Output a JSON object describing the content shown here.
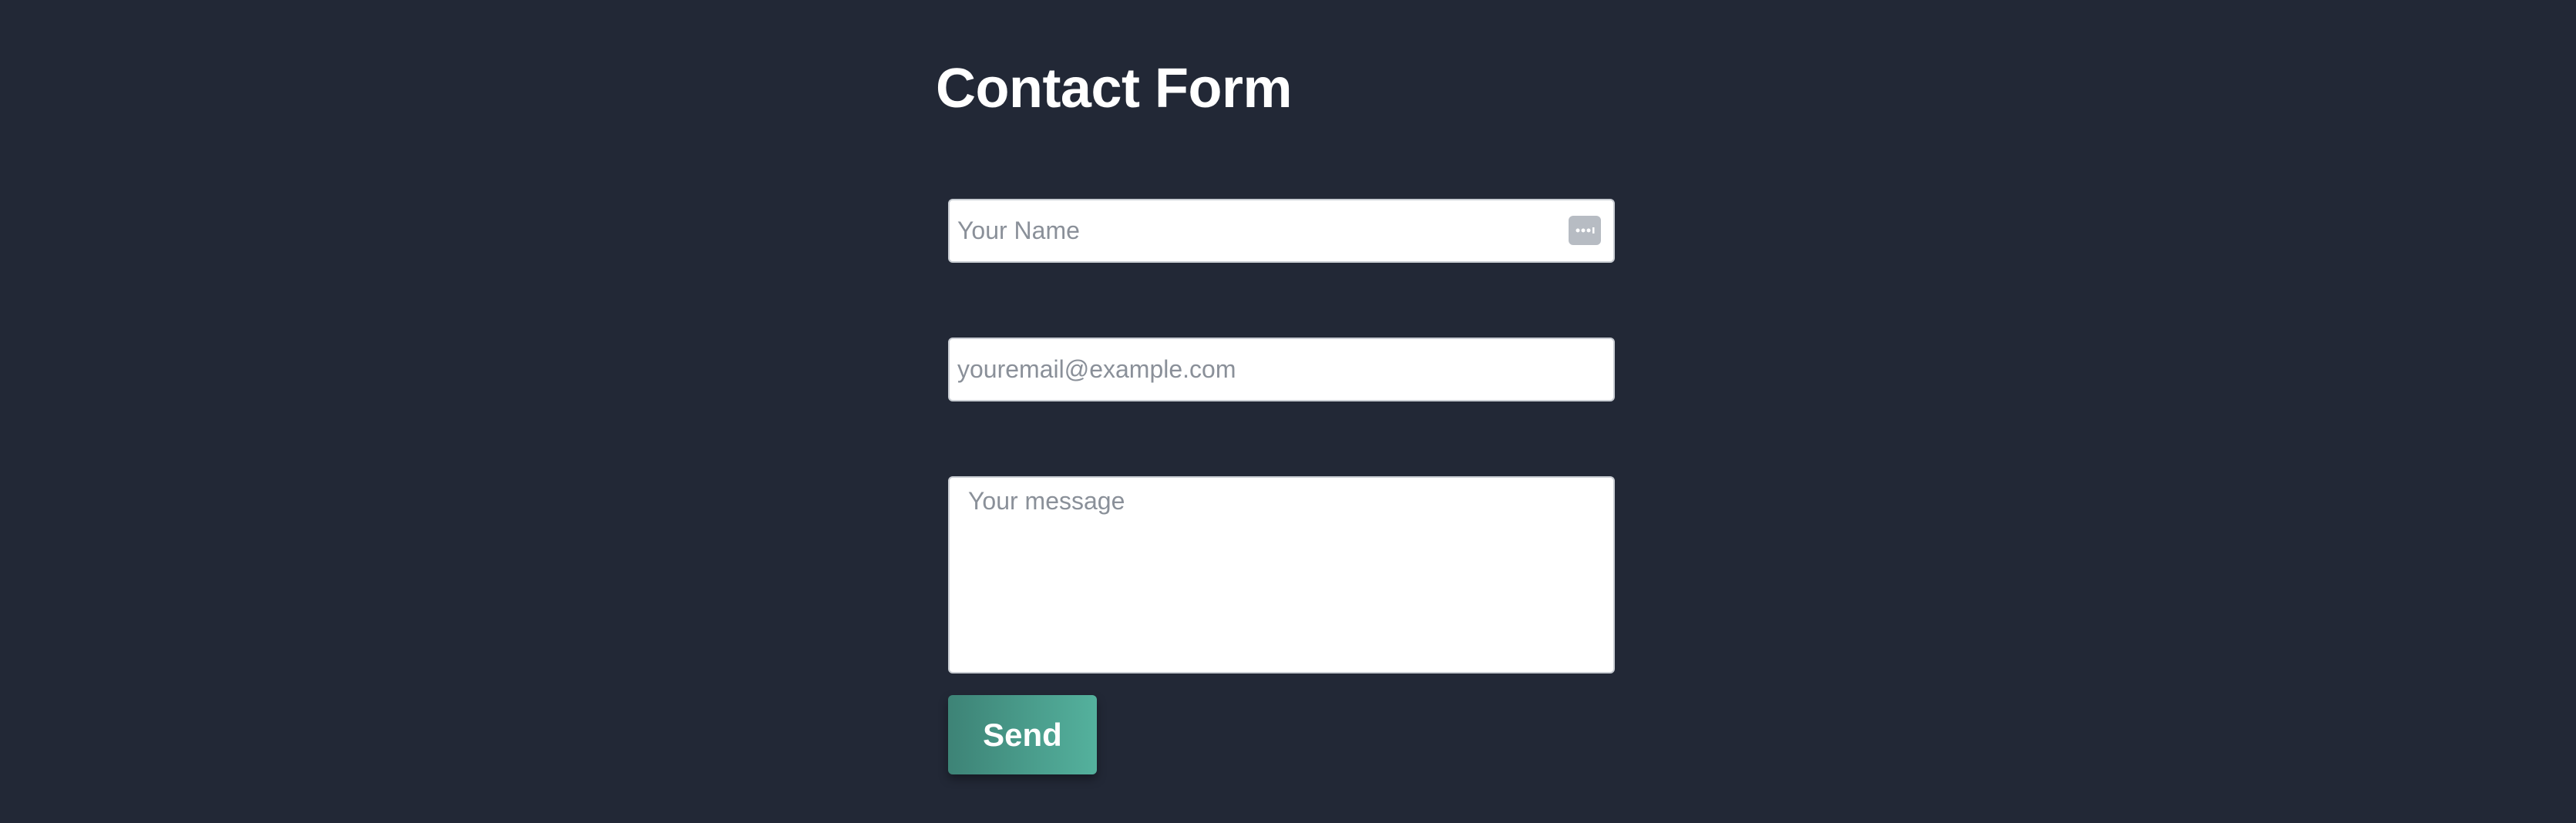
{
  "page": {
    "title": "Contact Form",
    "background_color": "#222836"
  },
  "form": {
    "name_field": {
      "placeholder": "Your Name",
      "value": "",
      "icon": "autofill-key-icon"
    },
    "email_field": {
      "placeholder": "youremail@example.com",
      "value": ""
    },
    "message_field": {
      "placeholder": "Your message",
      "value": ""
    },
    "submit_button": {
      "label": "Send",
      "gradient_start": "#3d8376",
      "gradient_end": "#54b19d"
    }
  }
}
